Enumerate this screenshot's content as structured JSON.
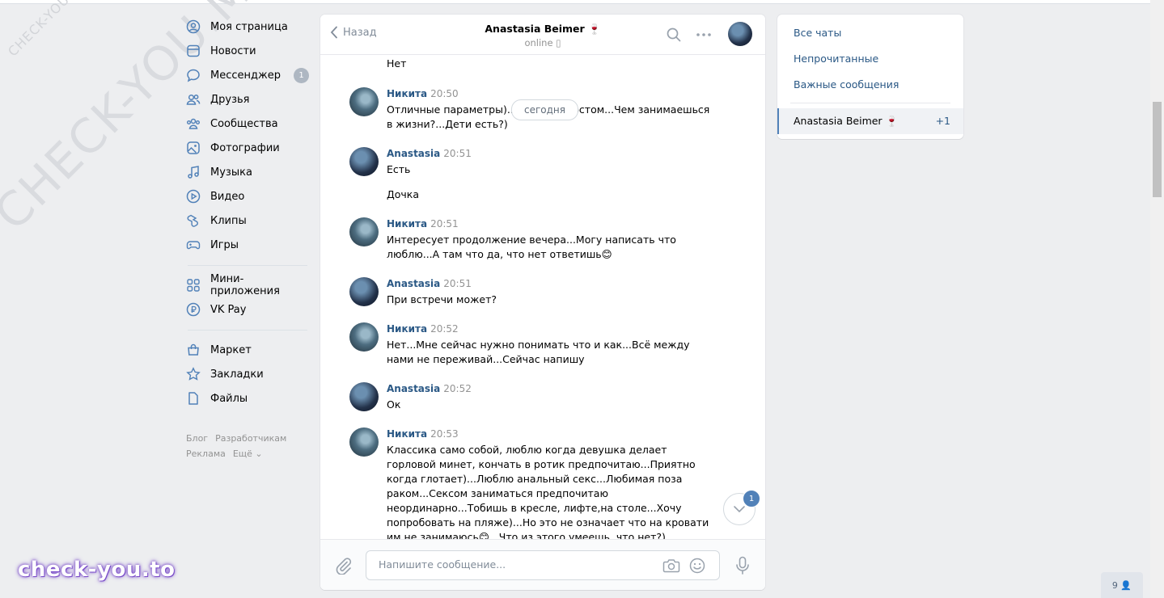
{
  "watermark": {
    "small": "CHECK-YOU.ME",
    "large": "CHECK-YOU.ME",
    "logo": "check-you.to"
  },
  "nav": {
    "items": [
      {
        "label": "Моя страница",
        "icon": "user-icon"
      },
      {
        "label": "Новости",
        "icon": "news-icon"
      },
      {
        "label": "Мессенджер",
        "icon": "messenger-icon",
        "badge": "1"
      },
      {
        "label": "Друзья",
        "icon": "friends-icon"
      },
      {
        "label": "Сообщества",
        "icon": "communities-icon"
      },
      {
        "label": "Фотографии",
        "icon": "photos-icon"
      },
      {
        "label": "Музыка",
        "icon": "music-icon"
      },
      {
        "label": "Видео",
        "icon": "video-icon"
      },
      {
        "label": "Клипы",
        "icon": "clips-icon"
      },
      {
        "label": "Игры",
        "icon": "games-icon"
      }
    ],
    "items2": [
      {
        "label": "Мини-приложения",
        "icon": "apps-icon"
      },
      {
        "label": "VK Pay",
        "icon": "vkpay-icon"
      }
    ],
    "items3": [
      {
        "label": "Маркет",
        "icon": "market-icon"
      },
      {
        "label": "Закладки",
        "icon": "bookmarks-icon"
      },
      {
        "label": "Файлы",
        "icon": "files-icon"
      }
    ],
    "footer": {
      "blog": "Блог",
      "developers": "Разработчикам",
      "ads": "Реклама",
      "more": "Ещё ⌄"
    }
  },
  "chat": {
    "back_label": "Назад",
    "contact_name": "Anastasia Beimer 🍷",
    "status": "online ▯",
    "date_pill": "сегодня",
    "first_line": "Нет",
    "messages": [
      {
        "author": "Никита",
        "time": "20:50",
        "text": "Отличные параметры)...Сам 1.82 ростом...Чем занимаешься в жизни?...Дети есть?)"
      },
      {
        "author": "Anastasia",
        "time": "20:51",
        "text": "Есть",
        "extra": "Дочка"
      },
      {
        "author": "Никита",
        "time": "20:51",
        "text": "Интересует продолжение вечера...Могу написать что люблю...А там что да, что нет ответишь😊"
      },
      {
        "author": "Anastasia",
        "time": "20:51",
        "text": "При встречи может?"
      },
      {
        "author": "Никита",
        "time": "20:52",
        "text": "Нет...Мне сейчас нужно понимать что и как...Всё между нами не переживай...Сейчас напишу"
      },
      {
        "author": "Anastasia",
        "time": "20:52",
        "text": "Ок"
      },
      {
        "author": "Никита",
        "time": "20:53",
        "text": "Классика само собой, люблю когда девушка делает горловой минет, кончать в ротик предпочитаю...Приятно когда глотает)...Люблю анальный секс...Любимая поза раком...Сексом заниматься предпочитаю неординарно...Тобишь в кресле, лифте,на столе...Хочу попробовать на пляже)...Но это не означает что на кровати им не занимаюсь😊...Что из этого умеешь, что нет?)"
      }
    ],
    "unread_badge": "1",
    "composer_placeholder": "Напишите сообщение..."
  },
  "right_panel": {
    "all_chats": "Все чаты",
    "unread": "Непрочитанные",
    "important": "Важные сообщения",
    "conversation": {
      "name": "Anastasia Beimer 🍷",
      "count": "+1"
    }
  },
  "online_counter": "9 👤"
}
